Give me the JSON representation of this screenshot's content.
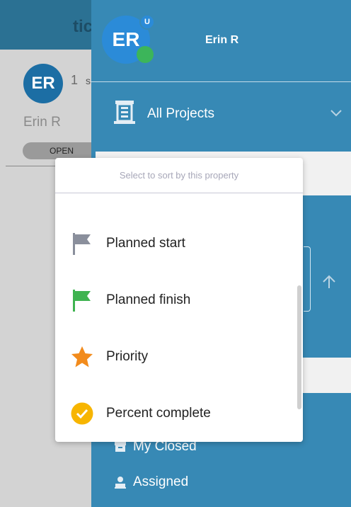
{
  "background": {
    "header_title": "tic",
    "avatar_initials": "ER",
    "count": "1",
    "count_suffix": "s",
    "user_name": "Erin R",
    "status": "OPEN"
  },
  "drawer": {
    "avatar_initials": "ER",
    "avatar_badge": "U",
    "user_name": "Erin R",
    "projects_label": "All Projects",
    "nav_items": [
      {
        "label": "My Closed",
        "icon": "archive-icon"
      },
      {
        "label": "Assigned",
        "icon": "assigned-icon"
      }
    ]
  },
  "sort_popup": {
    "hint": "Select to sort by this property",
    "items": [
      {
        "label": "Planned start",
        "icon": "gray-flag-icon"
      },
      {
        "label": "Planned finish",
        "icon": "green-flag-icon"
      },
      {
        "label": "Priority",
        "icon": "star-icon"
      },
      {
        "label": "Percent complete",
        "icon": "check-circle-icon"
      }
    ]
  },
  "colors": {
    "header": "#2b7193",
    "drawer": "#3789b5",
    "avatar": "#2b8bd8",
    "online": "#3cb55a",
    "flag_gray": "#8a8f9c",
    "flag_green": "#3fb350",
    "star": "#f28b1c",
    "check": "#f7b500"
  }
}
